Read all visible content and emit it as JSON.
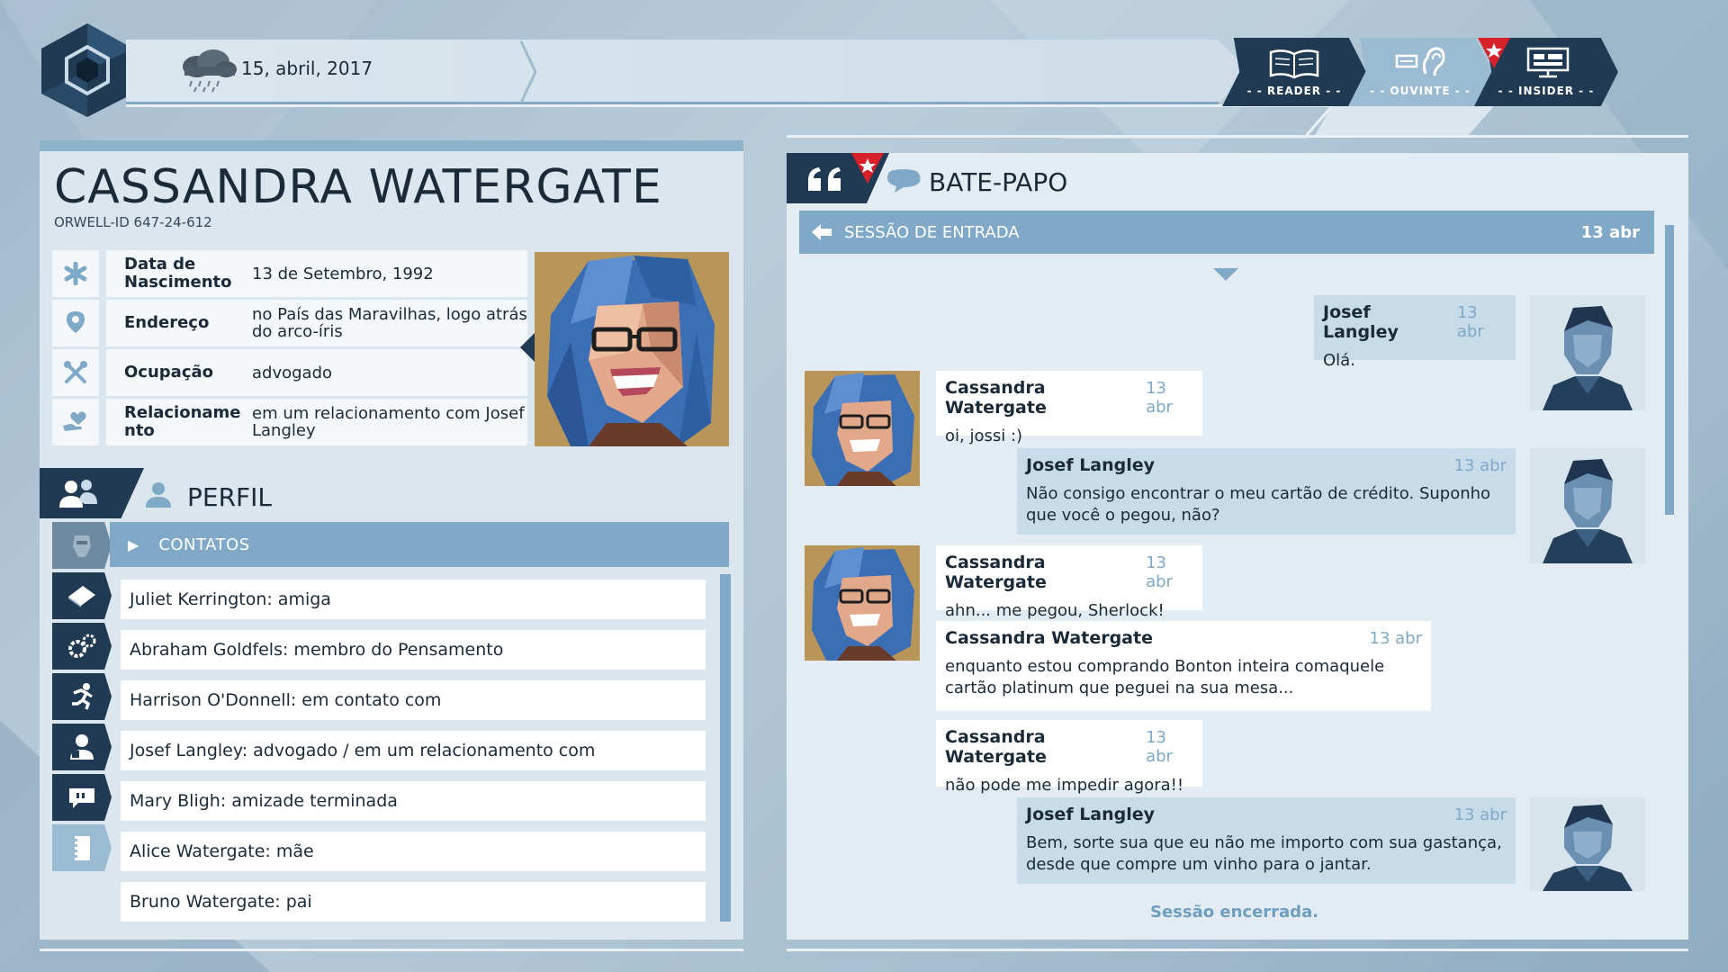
{
  "header": {
    "date": "15, abril, 2017",
    "weather_icon": "rain-cloud-icon",
    "modes": [
      {
        "label": "- - READER - -",
        "icon": "book-icon",
        "active": false
      },
      {
        "label": "- - OUVINTE - -",
        "icon": "ear-icon",
        "active": true
      },
      {
        "label": "- - INSIDER - -",
        "icon": "monitor-icon",
        "active": false
      }
    ]
  },
  "profile": {
    "name": "CASSANDRA WATERGATE",
    "orwell_id": "ORWELL-ID  647-24-612",
    "fields": [
      {
        "label": "Data de Nascimento",
        "value": "13 de Setembro, 1992",
        "icon": "asterisk-icon"
      },
      {
        "label": "Endereço",
        "value": "no País das Maravilhas, logo atrás do arco-íris",
        "icon": "location-pin-icon"
      },
      {
        "label": "Ocupação",
        "value": "advogado",
        "icon": "tools-icon"
      },
      {
        "label": "Relacionamento",
        "label_display": "Relacioname nto",
        "value": "em um relacionamento com Josef Langley",
        "icon": "heart-hand-icon"
      }
    ]
  },
  "perfil": {
    "title": "PERFIL",
    "section": "CONTATOS",
    "contacts": [
      "Juliet Kerrington: amiga",
      "Abraham Goldfels: membro do Pensamento",
      "Harrison O'Donnell: em contato com",
      "Josef Langley: advogado / em um relacionamento com",
      "Mary Bligh: amizade terminada",
      "Alice Watergate: mãe",
      "Bruno Watergate: pai"
    ],
    "side_icons": [
      "face-icon",
      "document-icon",
      "gears-icon",
      "running-icon",
      "person-badge-icon",
      "chat-bubble-icon",
      "notepad-icon"
    ]
  },
  "chat": {
    "title": "BATE-PAPO",
    "session_label": "SESSÃO DE ENTRADA",
    "session_date": "13 abr",
    "messages": [
      {
        "author": "Josef Langley",
        "time": "13 abr",
        "text": "Olá.",
        "side": "right"
      },
      {
        "author": "Cassandra Watergate",
        "time": "13 abr",
        "text": "oi, jossi :)",
        "side": "left"
      },
      {
        "author": "Josef Langley",
        "time": "13 abr",
        "text": "Não consigo encontrar o meu cartão de crédito. Suponho que você o pegou, não?",
        "side": "right"
      },
      {
        "author": "Cassandra Watergate",
        "time": "13 abr",
        "text": "ahn... me pegou, Sherlock!",
        "side": "left"
      },
      {
        "author": "Cassandra Watergate",
        "time": "13 abr",
        "text": "enquanto estou comprando Bonton inteira comaquele cartão platinum que peguei na sua mesa...",
        "side": "left"
      },
      {
        "author": "Cassandra Watergate",
        "time": "13 abr",
        "text": "não pode me impedir agora!!",
        "side": "left"
      },
      {
        "author": "Josef Langley",
        "time": "13 abr",
        "text": "Bem, sorte sua que eu não me importo com sua gastança, desde que compre um vinho para o jantar.",
        "side": "right"
      }
    ],
    "session_end": "Sessão encerrada."
  },
  "colors": {
    "dark_navy": "#1f3a52",
    "accent_blue": "#7fa9c7",
    "panel_bg": "#dbe6ee",
    "red_badge": "#d6202a"
  }
}
